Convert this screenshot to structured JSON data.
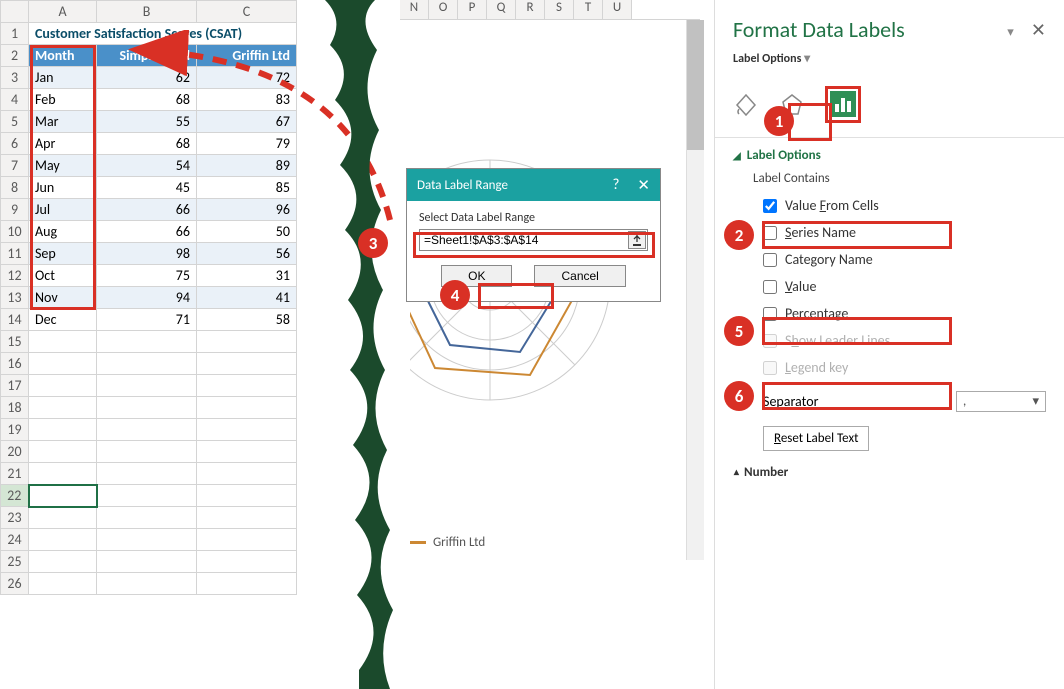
{
  "spreadsheet": {
    "title": "Customer Satisfaction Scores (CSAT)",
    "headers": {
      "a": "Month",
      "b": "Simpson Ltd",
      "c": "Griffin Ltd"
    },
    "col_letters": [
      "A",
      "B",
      "C"
    ],
    "rows": [
      {
        "n": "1"
      },
      {
        "n": "2"
      },
      {
        "n": "3"
      },
      {
        "n": "4"
      },
      {
        "n": "5"
      },
      {
        "n": "6"
      },
      {
        "n": "7"
      },
      {
        "n": "8"
      },
      {
        "n": "9"
      },
      {
        "n": "10"
      },
      {
        "n": "11"
      },
      {
        "n": "12"
      },
      {
        "n": "13"
      },
      {
        "n": "14"
      },
      {
        "n": "15"
      },
      {
        "n": "16"
      },
      {
        "n": "17"
      },
      {
        "n": "18"
      },
      {
        "n": "19"
      },
      {
        "n": "20"
      },
      {
        "n": "21"
      },
      {
        "n": "22"
      },
      {
        "n": "23"
      },
      {
        "n": "24"
      },
      {
        "n": "25"
      },
      {
        "n": "26"
      }
    ],
    "data": [
      {
        "a": "Jan",
        "b": "62",
        "c": "72"
      },
      {
        "a": "Feb",
        "b": "68",
        "c": "83"
      },
      {
        "a": "Mar",
        "b": "55",
        "c": "67"
      },
      {
        "a": "Apr",
        "b": "68",
        "c": "79"
      },
      {
        "a": "May",
        "b": "54",
        "c": "89"
      },
      {
        "a": "Jun",
        "b": "45",
        "c": "85"
      },
      {
        "a": "Jul",
        "b": "66",
        "c": "96"
      },
      {
        "a": "Aug",
        "b": "66",
        "c": "50"
      },
      {
        "a": "Sep",
        "b": "98",
        "c": "56"
      },
      {
        "a": "Oct",
        "b": "75",
        "c": "31"
      },
      {
        "a": "Nov",
        "b": "94",
        "c": "41"
      },
      {
        "a": "Dec",
        "b": "71",
        "c": "58"
      }
    ]
  },
  "chart_cols": [
    "N",
    "O",
    "P",
    "Q",
    "R",
    "S",
    "T",
    "U"
  ],
  "chart_legend": "Griffin Ltd",
  "dialog": {
    "title": "Data Label Range",
    "help": "?",
    "close": "✕",
    "label": "Select Data Label Range",
    "value": "=Sheet1!$A$3:$A$14",
    "ok": "OK",
    "cancel": "Cancel"
  },
  "pane": {
    "title": "Format Data Labels",
    "subtitle": "Label Options",
    "section_label_options": "Label Options",
    "label_contains": "Label Contains",
    "cb_value_from_cells": "Value From Cells",
    "cb_series_name": "Series Name",
    "cb_category_name": "Category Name",
    "cb_value": "Value",
    "cb_percentage": "Percentage",
    "cb_show_leader": "Show Leader Lines",
    "cb_legend_key": "Legend key",
    "separator_label": "Separator",
    "separator_value": ",",
    "reset": "Reset Label Text",
    "number_section": "Number"
  },
  "circles": {
    "c1": "1",
    "c2": "2",
    "c3": "3",
    "c4": "4",
    "c5": "5",
    "c6": "6"
  }
}
